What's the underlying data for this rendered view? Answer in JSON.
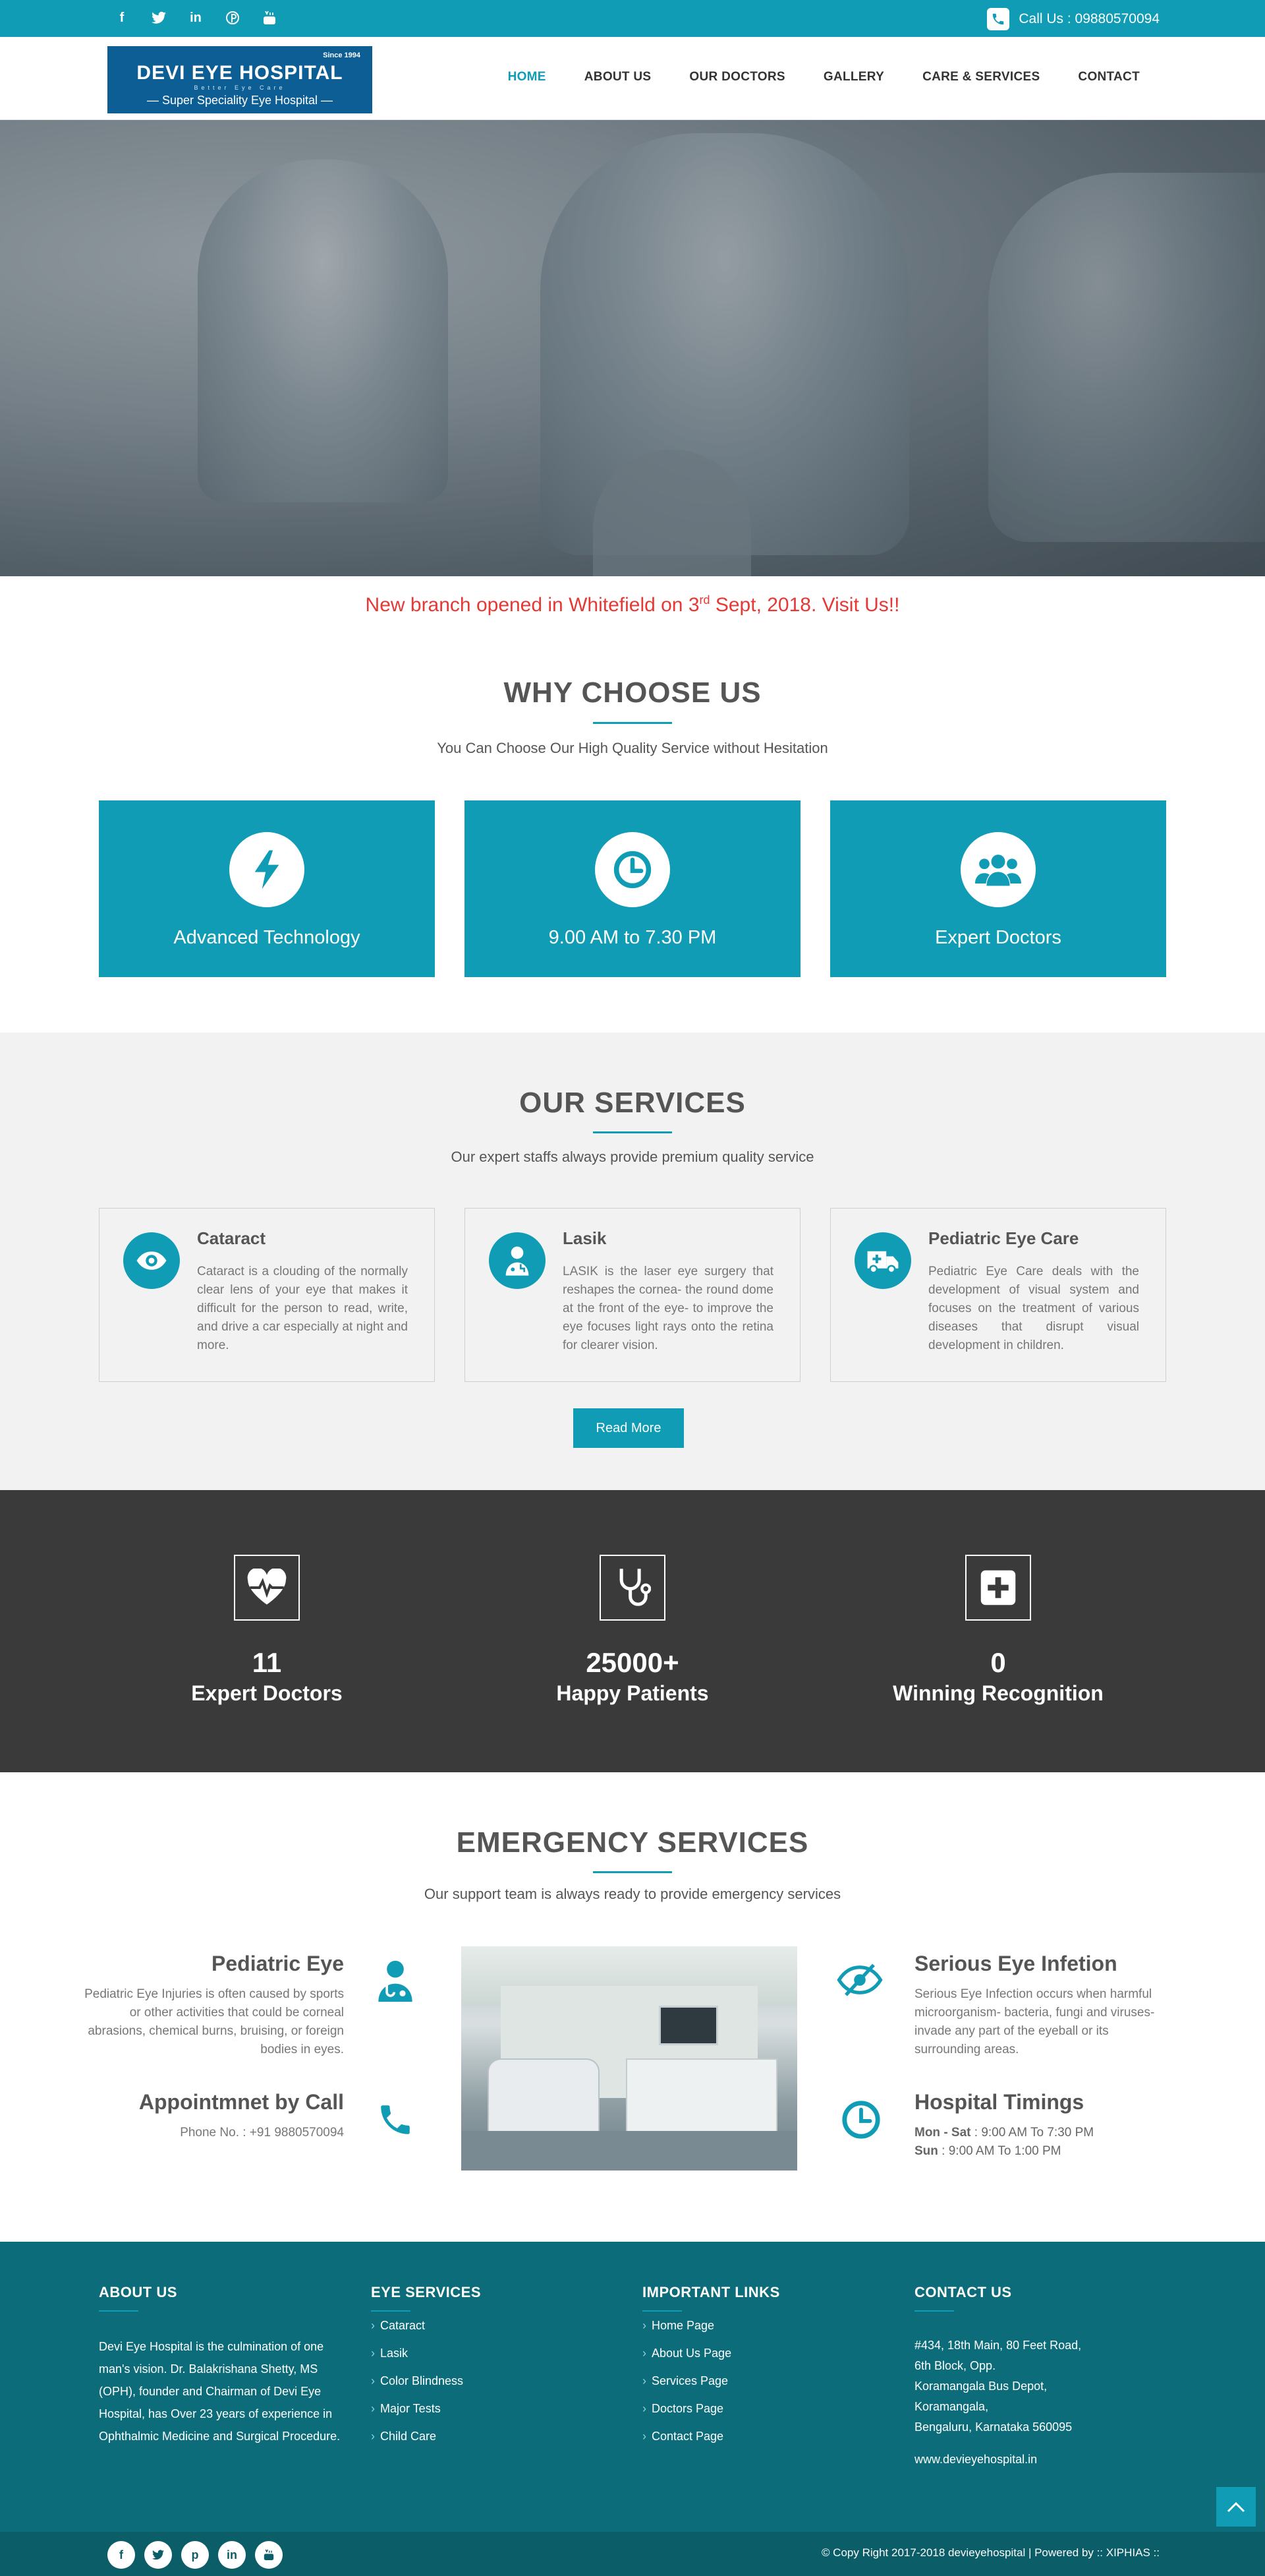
{
  "topbar": {
    "socials": [
      "facebook-icon",
      "twitter-icon",
      "linkedin-icon",
      "pinterest-icon",
      "youtube-icon"
    ],
    "call_label": "Call Us : 09880570094"
  },
  "header": {
    "logo": {
      "since": "Since 1994",
      "name": "DEVI EYE HOSPITAL",
      "tagline": "Better Eye Care",
      "specialty": "— Super Speciality Eye Hospital —"
    },
    "nav": [
      "HOME",
      "ABOUT US",
      "OUR DOCTORS",
      "GALLERY",
      "CARE & SERVICES",
      "CONTACT"
    ],
    "active_nav": "HOME"
  },
  "announcement": {
    "text_before": "New branch opened in Whitefield on 3",
    "sup": "rd",
    "text_after": " Sept, 2018. Visit Us!!"
  },
  "why": {
    "title": "WHY CHOOSE US",
    "subtitle": "You Can Choose Our High Quality Service without Hesitation",
    "items": [
      {
        "icon": "bolt-icon",
        "label": "Advanced Technology"
      },
      {
        "icon": "clock-icon",
        "label": "9.00 AM to 7.30 PM"
      },
      {
        "icon": "users-icon",
        "label": "Expert Doctors"
      }
    ]
  },
  "services": {
    "title": "OUR SERVICES",
    "subtitle": "Our expert staffs always provide premium quality service",
    "items": [
      {
        "icon": "eye-icon",
        "title": "Cataract",
        "desc": "Cataract is a clouding of the normally clear lens of your eye that makes it difficult for the person to read, write, and drive a car especially at night and more."
      },
      {
        "icon": "doctor-icon",
        "title": "Lasik",
        "desc": "LASIK is the laser eye surgery that reshapes the cornea- the round dome at the front of the eye- to improve the eye focuses light rays onto the retina for clearer vision."
      },
      {
        "icon": "ambulance-icon",
        "title": "Pediatric Eye Care",
        "desc": "Pediatric Eye Care deals with the development of visual system and focuses on the treatment of various diseases that disrupt visual development in children."
      }
    ],
    "read_more": "Read More"
  },
  "counters": [
    {
      "icon": "heartbeat-icon",
      "number": "11",
      "label": "Expert Doctors"
    },
    {
      "icon": "stethoscope-icon",
      "number": "25000+",
      "label": "Happy Patients"
    },
    {
      "icon": "plus-square-icon",
      "number": "0",
      "label": "Winning Recognition"
    }
  ],
  "emergency": {
    "title": "EMERGENCY SERVICES",
    "subtitle": "Our support team is always ready to provide emergency services",
    "left": [
      {
        "icon": "user-doctor-icon",
        "title": "Pediatric Eye",
        "desc": "Pediatric Eye Injuries is often caused by sports or other activities that could be corneal abrasions, chemical burns, bruising, or foreign bodies in eyes."
      },
      {
        "icon": "phone-icon",
        "title": "Appointmnet by Call",
        "desc": "Phone No. : +91 9880570094"
      }
    ],
    "right": [
      {
        "icon": "eye-slash-icon",
        "title": "Serious Eye Infetion",
        "desc": "Serious Eye Infection occurs when harmful microorganism- bacteria, fungi and viruses- invade any part of the eyeball or its surrounding areas."
      },
      {
        "icon": "clock-outline-icon",
        "title": "Hospital Timings",
        "mon_label": "Mon - Sat",
        "mon_value": " : 9:00 AM To 7:30 PM",
        "sun_label": "Sun",
        "sun_value": " : 9:00 AM To 1:00 PM"
      }
    ]
  },
  "footer": {
    "about": {
      "heading": "ABOUT US",
      "text": "Devi Eye Hospital is the culmination of one man's vision. Dr. Balakrishana Shetty, MS (OPH), founder and Chairman of Devi Eye Hospital, has Over 23 years of experience in Ophthalmic Medicine and Surgical Procedure."
    },
    "eye_services": {
      "heading": "EYE SERVICES",
      "links": [
        "Cataract",
        "Lasik",
        "Color Blindness",
        "Major Tests",
        "Child Care"
      ]
    },
    "important_links": {
      "heading": "IMPORTANT LINKS",
      "links": [
        "Home Page",
        "About Us Page",
        "Services Page",
        "Doctors Page",
        "Contact Page"
      ]
    },
    "contact": {
      "heading": "CONTACT US",
      "lines": [
        "#434, 18th Main, 80 Feet Road,",
        "6th Block, Opp.",
        "Koramangala Bus Depot,",
        "Koramangala,",
        "Bengaluru, Karnataka 560095"
      ],
      "website": "www.devieyehospital.in"
    },
    "bottom_socials": [
      "facebook-icon",
      "twitter-icon",
      "pinterest-icon",
      "linkedin-icon",
      "youtube-icon"
    ],
    "copyright": "© Copy Right 2017-2018 devieyehospital | Powered by :: XIPHIAS ::"
  },
  "colors": {
    "accent": "#119cb5",
    "dark": "#3a3a3a",
    "footer": "#0d6c79",
    "announcement": "#e53935"
  }
}
